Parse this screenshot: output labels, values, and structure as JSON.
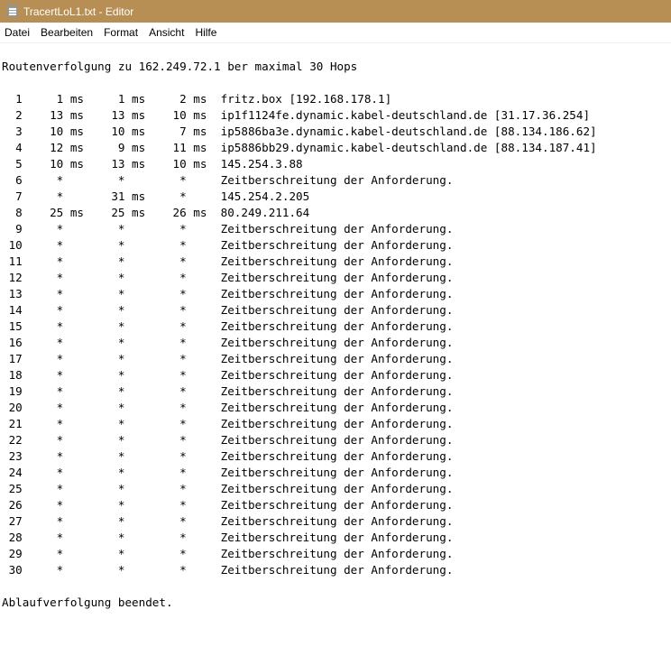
{
  "window": {
    "title": "TracertLoL1.txt - Editor"
  },
  "menu": [
    {
      "label": "Datei"
    },
    {
      "label": "Bearbeiten"
    },
    {
      "label": "Format"
    },
    {
      "label": "Ansicht"
    },
    {
      "label": "Hilfe"
    }
  ],
  "document": {
    "lines": [
      "Routenverfolgung zu 162.249.72.1 ber maximal 30 Hops",
      "",
      "  1     1 ms     1 ms     2 ms  fritz.box [192.168.178.1]",
      "  2    13 ms    13 ms    10 ms  ip1f1124fe.dynamic.kabel-deutschland.de [31.17.36.254]",
      "  3    10 ms    10 ms     7 ms  ip5886ba3e.dynamic.kabel-deutschland.de [88.134.186.62]",
      "  4    12 ms     9 ms    11 ms  ip5886bb29.dynamic.kabel-deutschland.de [88.134.187.41]",
      "  5    10 ms    13 ms    10 ms  145.254.3.88",
      "  6     *        *        *     Zeitberschreitung der Anforderung.",
      "  7     *       31 ms     *     145.254.2.205",
      "  8    25 ms    25 ms    26 ms  80.249.211.64",
      "  9     *        *        *     Zeitberschreitung der Anforderung.",
      " 10     *        *        *     Zeitberschreitung der Anforderung.",
      " 11     *        *        *     Zeitberschreitung der Anforderung.",
      " 12     *        *        *     Zeitberschreitung der Anforderung.",
      " 13     *        *        *     Zeitberschreitung der Anforderung.",
      " 14     *        *        *     Zeitberschreitung der Anforderung.",
      " 15     *        *        *     Zeitberschreitung der Anforderung.",
      " 16     *        *        *     Zeitberschreitung der Anforderung.",
      " 17     *        *        *     Zeitberschreitung der Anforderung.",
      " 18     *        *        *     Zeitberschreitung der Anforderung.",
      " 19     *        *        *     Zeitberschreitung der Anforderung.",
      " 20     *        *        *     Zeitberschreitung der Anforderung.",
      " 21     *        *        *     Zeitberschreitung der Anforderung.",
      " 22     *        *        *     Zeitberschreitung der Anforderung.",
      " 23     *        *        *     Zeitberschreitung der Anforderung.",
      " 24     *        *        *     Zeitberschreitung der Anforderung.",
      " 25     *        *        *     Zeitberschreitung der Anforderung.",
      " 26     *        *        *     Zeitberschreitung der Anforderung.",
      " 27     *        *        *     Zeitberschreitung der Anforderung.",
      " 28     *        *        *     Zeitberschreitung der Anforderung.",
      " 29     *        *        *     Zeitberschreitung der Anforderung.",
      " 30     *        *        *     Zeitberschreitung der Anforderung.",
      "",
      "Ablaufverfolgung beendet."
    ]
  },
  "colors": {
    "titlebar": "#b78f55",
    "title_text": "#ffffff",
    "editor_background": "#ffffff"
  },
  "icons": {
    "app": "notepad-icon"
  }
}
